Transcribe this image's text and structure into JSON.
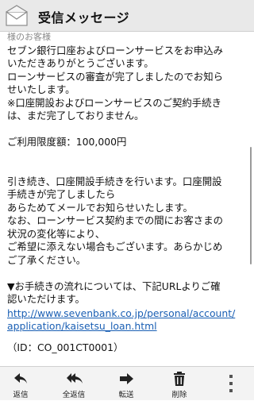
{
  "header": {
    "title": "受信メッセージ"
  },
  "message": {
    "top_fragment": "様のお客様",
    "lines": [
      "セブン銀行口座およびローンサービスをお申込み",
      "いただきありがとうございます。",
      "ローンサービスの審査が完了しましたのでお知ら",
      "せいたします。",
      "※口座開設およびローンサービスのご契約手続き",
      "は、まだ完了しておりません。",
      "ご利用限度額：100,000円",
      "引き続き、口座開設手続きを行います。口座開設",
      "手続きが完了しましたら",
      "あらためてメールでお知らせいたします。",
      "なお、ローンサービス契約までの間にお客さまの",
      "状況の変化等により、",
      "ご希望に添えない場合もございます。あらかじめ",
      "ご了承ください。",
      "▼お手続きの流れについては、下記URLよりご確",
      "認いただけます。"
    ],
    "link_lines": [
      "http://www.sevenbank.co.jp/personal/account/",
      "application/kaisetsu_loan.html"
    ],
    "id_line": "（ID：CO_001CT0001）"
  },
  "toolbar": {
    "reply": "返信",
    "reply_all": "全返信",
    "forward": "転送",
    "delete": "削除"
  },
  "icons": {
    "app": "envelope-icon",
    "reply": "reply-icon",
    "reply_all": "reply-all-icon",
    "forward": "forward-icon",
    "delete": "trash-icon",
    "more": "overflow-menu-icon"
  },
  "colors": {
    "link": "#1a5fb4",
    "header_bg": "#e9e9e9",
    "toolbar_bg": "#f3f3f3"
  }
}
